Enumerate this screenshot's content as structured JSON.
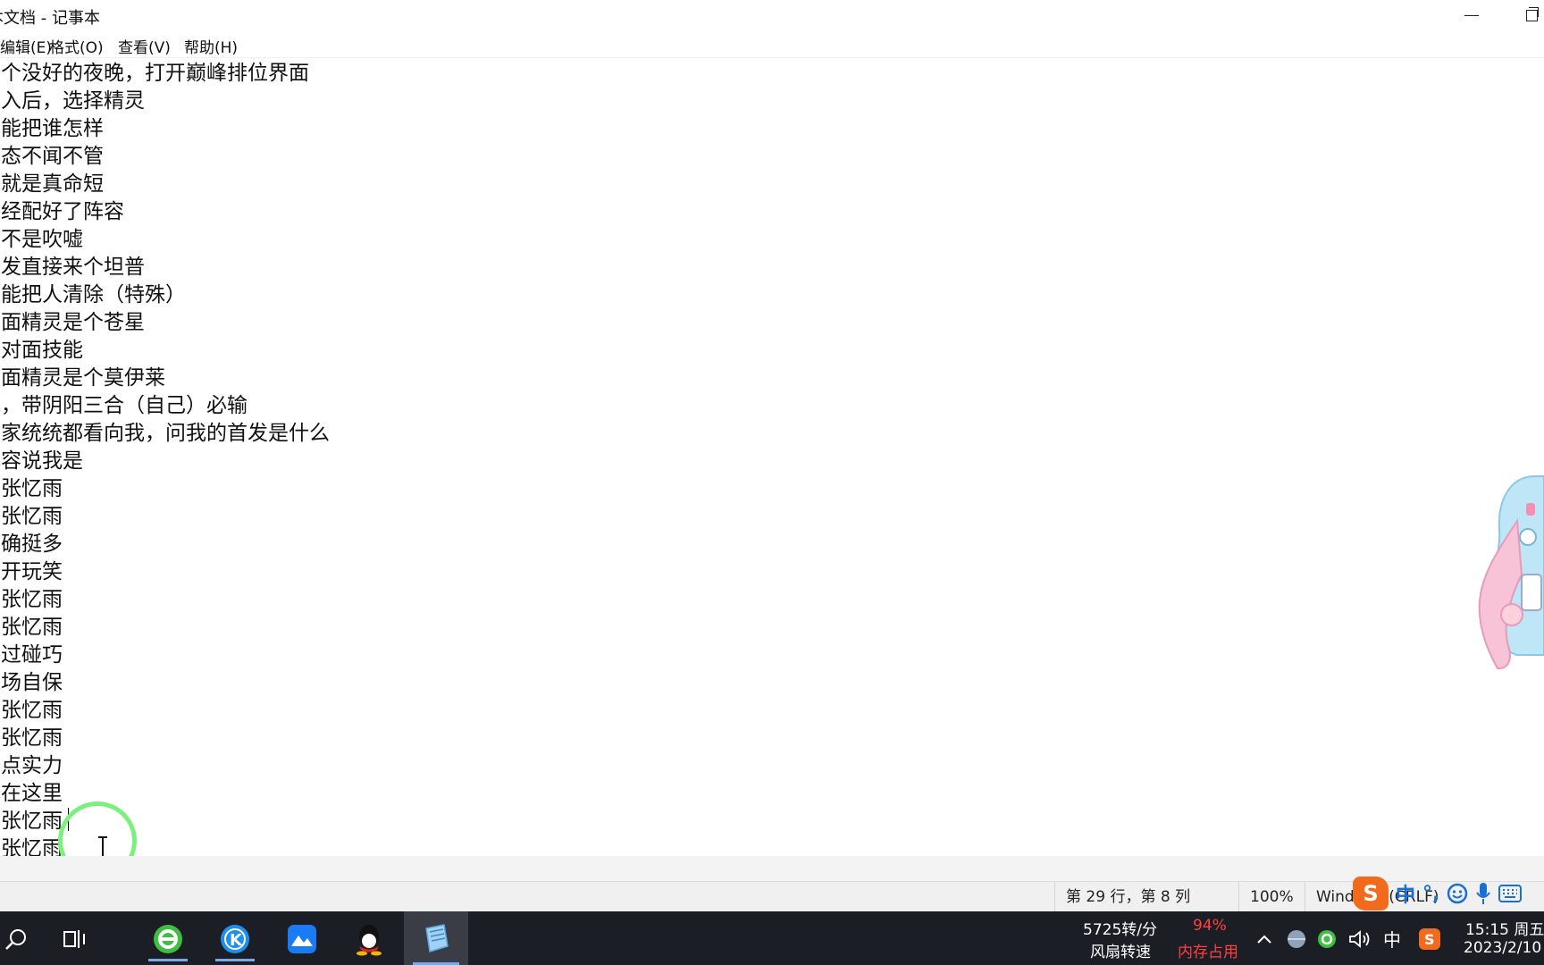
{
  "window": {
    "title": "本文档 - 记事本"
  },
  "menu": [
    "编辑(E)",
    "格式(O)",
    "查看(V)",
    "帮助(H)"
  ],
  "editor": {
    "lines": [
      "一个没好的夜晚，打开巅峰排位界面",
      "进入后，选择精灵",
      "不能把谁怎样",
      "心态不闻不管",
      "不就是真命短",
      "已经配好了阵容",
      "真不是吹嘘",
      "首发直接来个坦普",
      "不能把人清除（特殊）",
      "对面精灵是个苍星",
      "被对面技能",
      "对面精灵是个莫伊莱",
      "我，带阴阳三合（自己）必输",
      "大家统统都看向我，问我的首发是什么",
      "阵容说我是",
      "胡张忆雨",
      "胡张忆雨",
      "的确挺多",
      "别开玩笑",
      "胡张忆雨",
      "胡张忆雨",
      "路过碰巧",
      "下场自保",
      "胡张忆雨",
      "胡张忆雨",
      "一点实力",
      "我在这里",
      "胡张忆雨",
      "胡张忆雨"
    ]
  },
  "statusbar": {
    "position": "第 29 行，第 8 列",
    "zoom": "100%",
    "line_ending": "Windows (CRLF)"
  },
  "ime": {
    "mode": "中",
    "punct": "°,",
    "emoji_icon": "emoji-icon",
    "mic_icon": "microphone-icon",
    "keyboard_icon": "keyboard-icon"
  },
  "taskbar": {
    "apps": [
      "search-icon",
      "task-view-icon",
      "browser-icon",
      "kugou-icon",
      "cloud-app-icon",
      "qq-icon",
      "notepad-icon"
    ],
    "fan_speed_value": "5725转/分",
    "fan_speed_label": "风扇转速",
    "memory_value": "94%",
    "memory_label": "内存占用",
    "tray_ime": "中",
    "time": "15:15 周五",
    "date": "2023/2/10"
  },
  "colors": {
    "taskbar_bg": "#1b1e25",
    "memory_red": "#ff4040",
    "cursor_ring": "#7cf07c",
    "sogou_orange": "#f26b1d"
  }
}
